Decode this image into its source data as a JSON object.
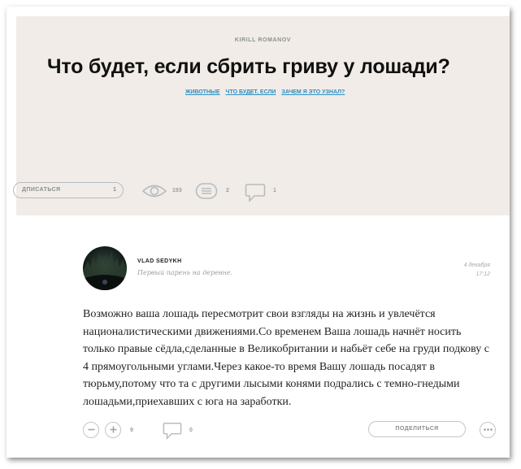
{
  "post": {
    "author": "KIRILL ROMANOV",
    "title": "Что будет, если сбрить гриву у лошади?",
    "tags": [
      "ЖИВОТНЫЕ",
      "ЧТО БУДЕТ, ЕСЛИ",
      "ЗАЧЕМ Я ЭТО УЗНАЛ?"
    ],
    "subscribe_label": "ДПИСАТЬСЯ",
    "subscribe_count": "1",
    "views": "193",
    "answers": "2",
    "comments": "1"
  },
  "comment": {
    "username": "VLAD SEDYKH",
    "tagline": "Первый парень на деревне.",
    "date": "4 декабря",
    "time": "17:12",
    "text": "Возможно ваша лошадь пересмотрит свои взгляды на жизнь и увлечётся националистическими движениями.Со временем Ваша лошадь начнёт носить только правые сёдла,сделанные в Великобритании и набьёт себе на груди подкову с 4 прямоугольными углами.Через какое-то время Вашу лошадь посадят в тюрьму,потому что та с другими лысыми конями подрались с темно-гнедыми лошадьми,приехавших с юга на заработки.",
    "rating": "9",
    "replies": "0",
    "share_label": "ПОДЕЛИТЬСЯ"
  },
  "colors": {
    "hero_bg": "#f1ece7",
    "link": "#2a8fc5"
  }
}
